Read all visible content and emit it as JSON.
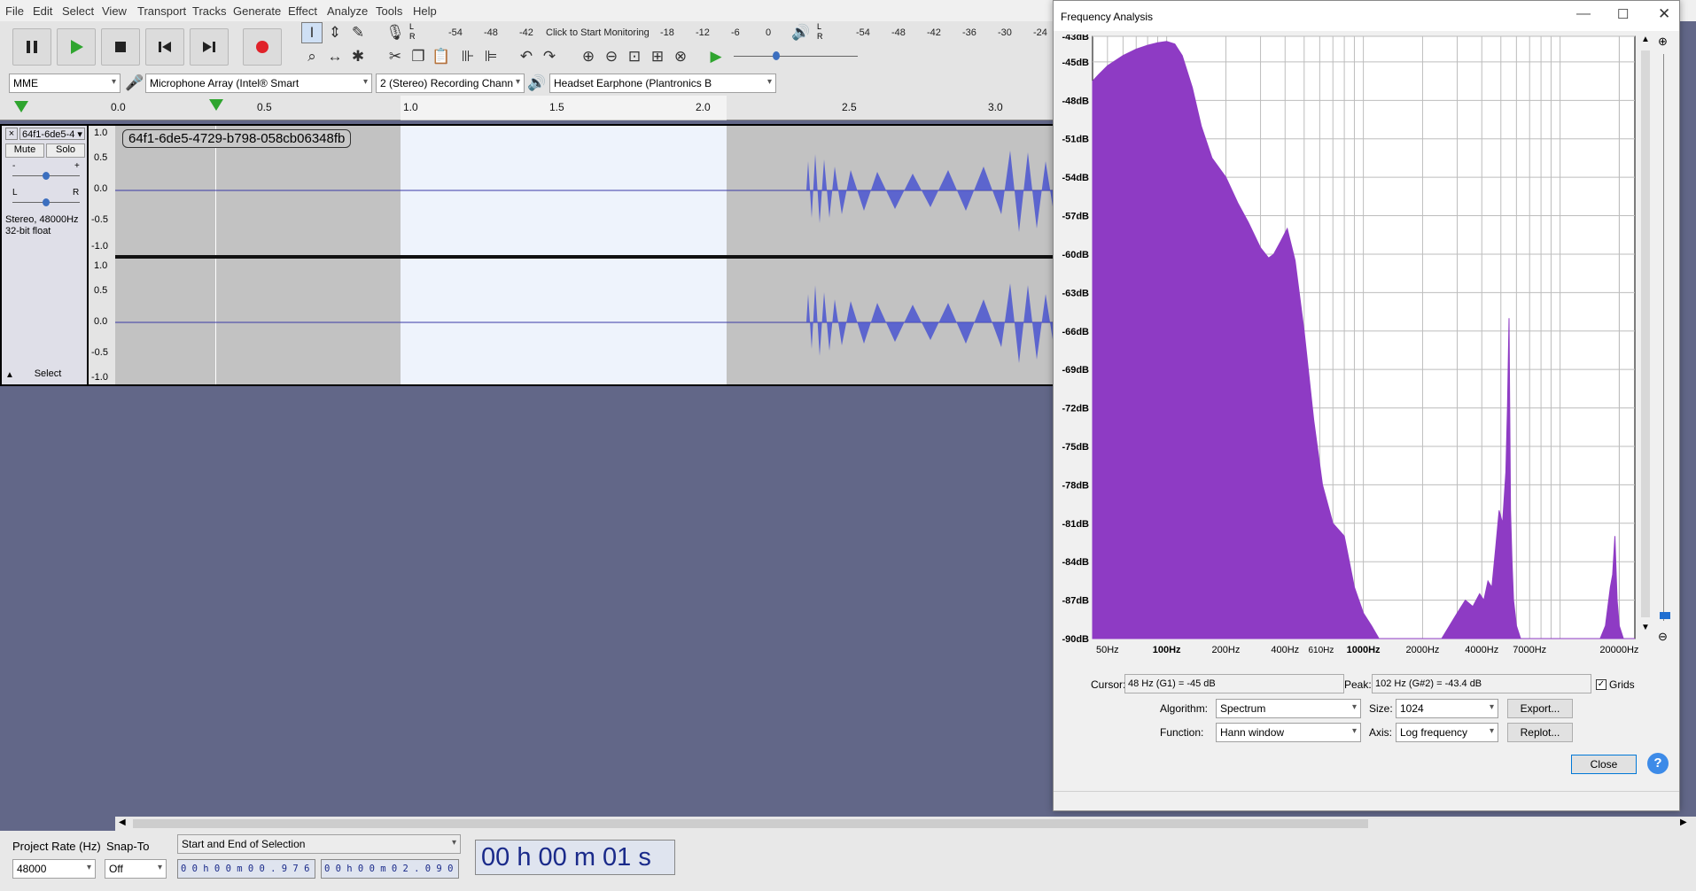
{
  "menu": [
    "File",
    "Edit",
    "Select",
    "View",
    "Transport",
    "Tracks",
    "Generate",
    "Effect",
    "Analyze",
    "Tools",
    "Help"
  ],
  "meters": {
    "record_ticks": [
      "-54",
      "-48",
      "-42",
      "Click to Start Monitoring",
      "-18",
      "-12",
      "-6",
      "0"
    ],
    "play_ticks": [
      "-54",
      "-48",
      "-42",
      "-36",
      "-30",
      "-24"
    ],
    "L": "L",
    "R": "R"
  },
  "device": {
    "host": "MME",
    "input": "Microphone Array (Intel® Smart",
    "channels": "2 (Stereo) Recording Chann",
    "output": "Headset Earphone (Plantronics B"
  },
  "ruler": [
    "0.0",
    "0.5",
    "1.0",
    "1.5",
    "2.0",
    "2.5",
    "3.0"
  ],
  "track": {
    "name": "64f1-6de5-4",
    "clip_name": "64f1-6de5-4729-b798-058cb06348fb",
    "mute": "Mute",
    "solo": "Solo",
    "gain_minus": "-",
    "gain_plus": "+",
    "pan_l": "L",
    "pan_r": "R",
    "info1": "Stereo, 48000Hz",
    "info2": "32-bit float",
    "select": "Select",
    "scale": [
      "1.0",
      "0.5",
      "0.0",
      "-0.5",
      "-1.0"
    ]
  },
  "bottom": {
    "project_rate_label": "Project Rate (Hz)",
    "project_rate": "48000",
    "snap_label": "Snap-To",
    "snap": "Off",
    "selection_mode": "Start and End of Selection",
    "sel_start": "0 0 h 0 0 m 0 0 . 9 7 6 s",
    "sel_end": "0 0 h 0 0 m 0 2 . 0 9 0 s",
    "time": "00 h 00 m 01 s"
  },
  "dialog": {
    "title": "Frequency Analysis",
    "cursor_label": "Cursor:",
    "cursor_value": "48 Hz (G1) = -45 dB",
    "peak_label": "Peak:",
    "peak_value": "102 Hz (G#2) = -43.4 dB",
    "grids_label": "Grids",
    "algorithm_label": "Algorithm:",
    "algorithm": "Spectrum",
    "size_label": "Size:",
    "size": "1024",
    "export": "Export...",
    "function_label": "Function:",
    "function": "Hann window",
    "axis_label": "Axis:",
    "axis": "Log frequency",
    "replot": "Replot...",
    "close": "Close",
    "help": "?"
  },
  "chart_data": {
    "type": "area",
    "title": "",
    "xlabel": "",
    "ylabel": "",
    "x_scale": "log",
    "grid": true,
    "color": "#8e3bc4",
    "y_ticks": [
      "-43dB",
      "-45dB",
      "-48dB",
      "-51dB",
      "-54dB",
      "-57dB",
      "-60dB",
      "-63dB",
      "-66dB",
      "-69dB",
      "-72dB",
      "-75dB",
      "-78dB",
      "-81dB",
      "-84dB",
      "-87dB",
      "-90dB"
    ],
    "x_ticks": [
      "50Hz",
      "100Hz",
      "200Hz",
      "400Hz",
      "610Hz",
      "1000Hz",
      "2000Hz",
      "4000Hz",
      "7000Hz",
      "20000Hz"
    ],
    "ylim": [
      -90,
      -43
    ],
    "xlim": [
      42,
      24000
    ],
    "series": [
      {
        "x": [
          42,
          45,
          50,
          60,
          70,
          80,
          90,
          100,
          110,
          120,
          135,
          150,
          170,
          200,
          230,
          260,
          300,
          330,
          350,
          380,
          410,
          450,
          500,
          560,
          620,
          700,
          800,
          900,
          1000,
          1100,
          1200,
          1300,
          1400,
          1500,
          1700,
          2000,
          2500,
          3000,
          3300,
          3600,
          3900,
          4100,
          4300,
          4500,
          4700,
          4900,
          5100,
          5300,
          5400,
          5500,
          5600,
          5700,
          5800,
          6000,
          6300,
          6700,
          7000,
          8000,
          10000,
          13000,
          16000,
          17000,
          18000,
          18500,
          19000,
          19500,
          20000,
          21000,
          24000
        ],
        "y": [
          -46.5,
          -46,
          -45.3,
          -44.5,
          -44,
          -43.7,
          -43.5,
          -43.4,
          -43.6,
          -44.5,
          -47,
          -50,
          -52.5,
          -54,
          -56,
          -57.5,
          -59.5,
          -60.3,
          -60,
          -59,
          -58,
          -60.5,
          -66,
          -73,
          -78,
          -81,
          -82,
          -86,
          -88,
          -89,
          -90,
          -90,
          -90,
          -90,
          -90,
          -90,
          -90,
          -88,
          -87,
          -87.5,
          -86.5,
          -87,
          -85.5,
          -86,
          -83,
          -80,
          -81,
          -77,
          -72,
          -65,
          -80,
          -84,
          -87,
          -89,
          -90,
          -90,
          -90,
          -90,
          -90,
          -90,
          -90,
          -89,
          -86,
          -85,
          -82,
          -87,
          -89,
          -90,
          -90
        ]
      }
    ]
  }
}
